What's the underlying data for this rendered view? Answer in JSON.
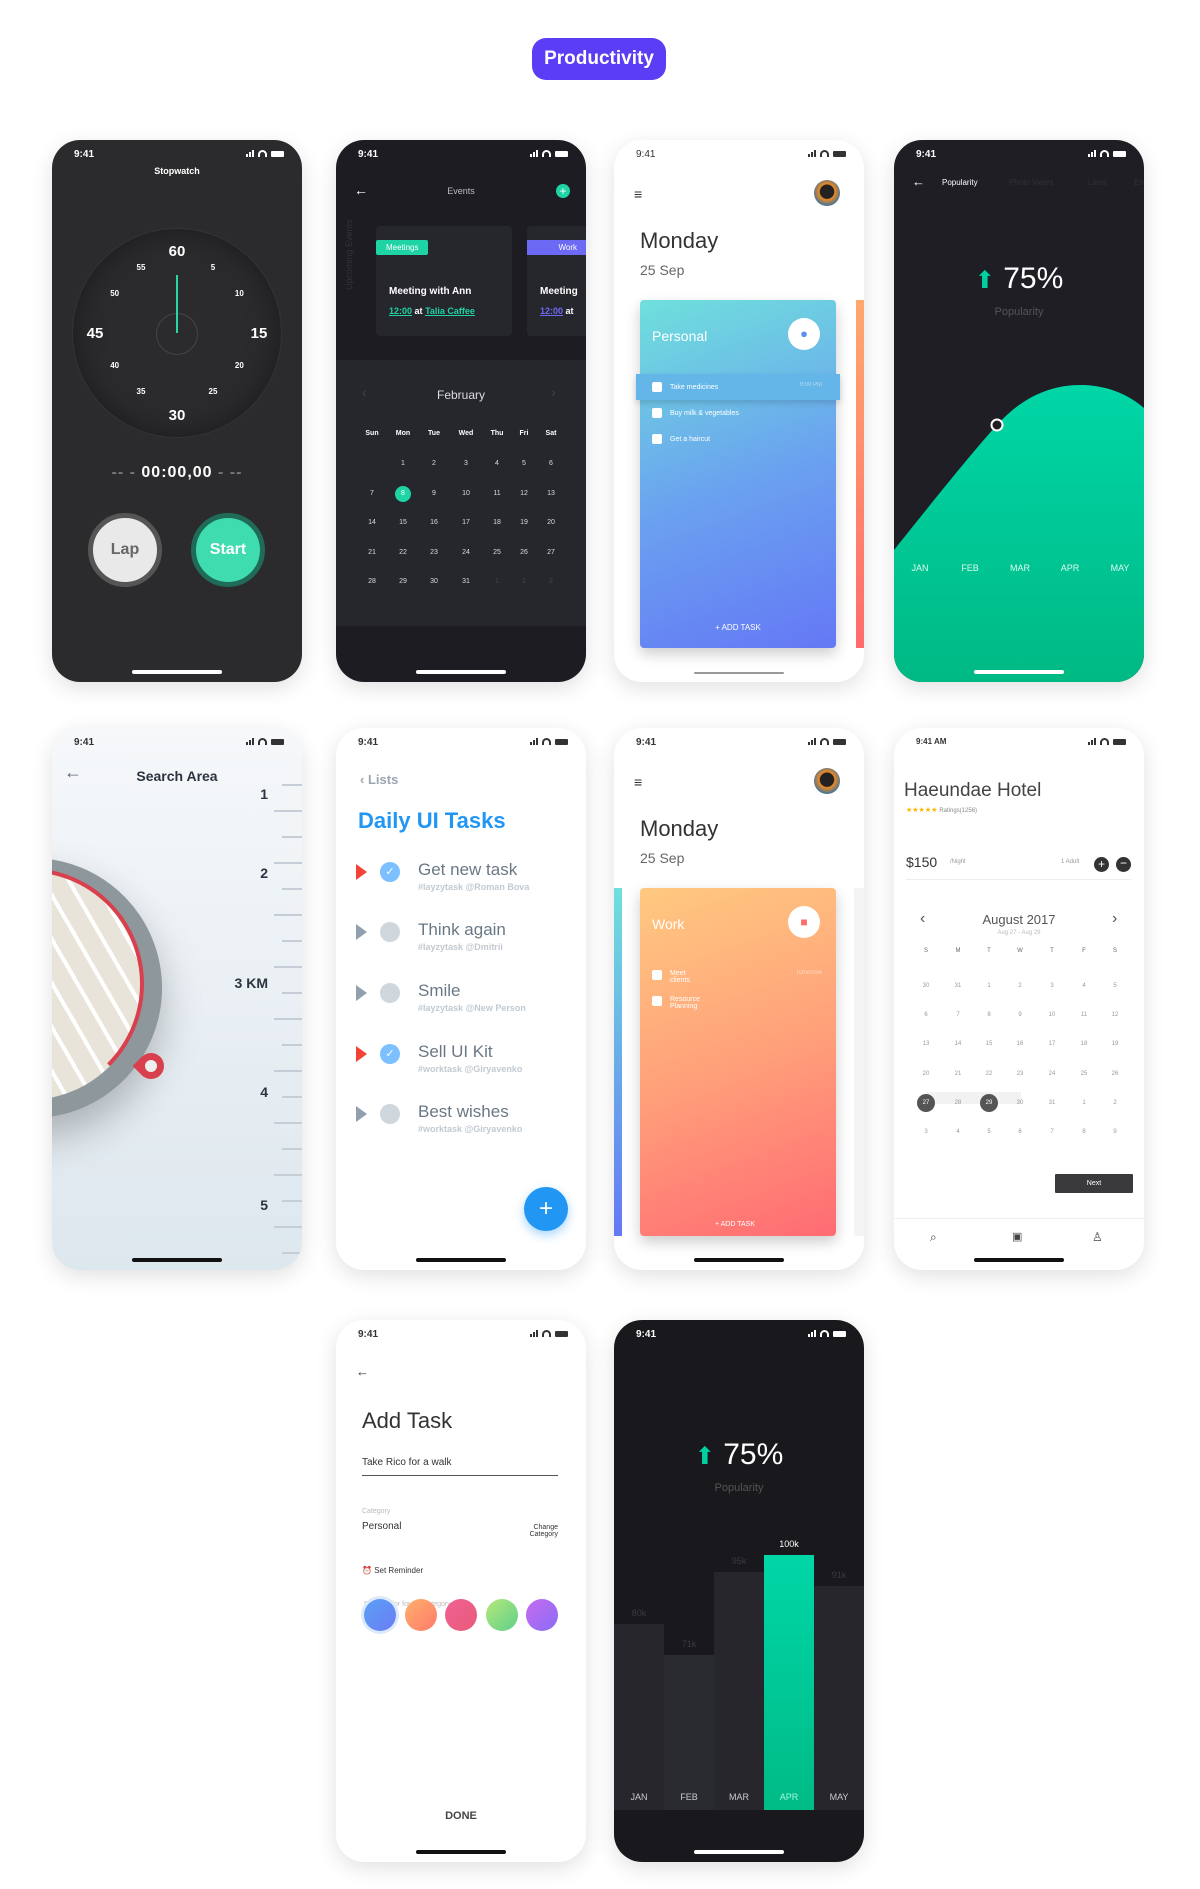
{
  "badge": "Productivity",
  "status_time": "9:41",
  "stopwatch": {
    "title": "Stopwatch",
    "dial": [
      "60",
      "5",
      "10",
      "15",
      "20",
      "25",
      "30",
      "35",
      "40",
      "45",
      "50",
      "55"
    ],
    "readout": "00:00,00",
    "lap": "Lap",
    "start": "Start"
  },
  "events": {
    "title": "Events",
    "side_label": "Upcoming Events",
    "cards": [
      {
        "tag": "Meetings",
        "title": "Meeting with Ann",
        "time": "12:00",
        "at": "at",
        "place": "Talia Caffee",
        "color": "#1ed3a4"
      },
      {
        "tag": "Work",
        "title": "Meeting",
        "time": "12:00",
        "at": "at",
        "color": "#6c6af4"
      }
    ],
    "month": "February",
    "weekdays": [
      "Sun",
      "Mon",
      "Tue",
      "Wed",
      "Thu",
      "Fri",
      "Sat"
    ],
    "rows": [
      [
        "",
        "1",
        "2",
        "3",
        "4",
        "5",
        "6"
      ],
      [
        "7",
        "8",
        "9",
        "10",
        "11",
        "12",
        "13"
      ],
      [
        "14",
        "15",
        "16",
        "17",
        "18",
        "19",
        "20"
      ],
      [
        "21",
        "22",
        "23",
        "24",
        "25",
        "26",
        "27"
      ],
      [
        "28",
        "29",
        "30",
        "31",
        "1",
        "2",
        "3"
      ]
    ],
    "selected": "8",
    "accent": "#1ed3a4"
  },
  "personal": {
    "day": "Monday",
    "date": "25 Sep",
    "card": "Personal",
    "tasks": [
      "Take medicines",
      "Buy milk & vegetables",
      "Get a haircut"
    ],
    "reminder": "9:00 PM",
    "add": "ADD TASK"
  },
  "popularity": {
    "tabs": [
      "Popularity",
      "Photo Views",
      "Likes",
      "En"
    ],
    "value": "75%",
    "label": "Popularity",
    "months": [
      "JAN",
      "FEB",
      "MAR",
      "APR",
      "MAY"
    ],
    "accent": "#00d1a0"
  },
  "search": {
    "title": "Search Area",
    "ruler": [
      "1",
      "2",
      "3 KM",
      "4",
      "5"
    ]
  },
  "tasks": {
    "back": "Lists",
    "title": "Daily UI Tasks",
    "items": [
      {
        "name": "Get new task",
        "tag": "#layzytask",
        "user": "@Roman Bova",
        "done": true
      },
      {
        "name": "Think again",
        "tag": "#layzytask",
        "user": "@Dmitrii",
        "done": false
      },
      {
        "name": "Smile",
        "tag": "#layzytask",
        "user": "@New Person",
        "done": false
      },
      {
        "name": "Sell UI Kit",
        "tag": "#worktask",
        "user": "@Giryavenko",
        "done": true
      },
      {
        "name": "Best wishes",
        "tag": "#worktask",
        "user": "@Giryavenko",
        "done": false
      }
    ],
    "fab": "+"
  },
  "work": {
    "day": "Monday",
    "date": "25 Sep",
    "card": "Work",
    "tasks": [
      "Meet clients",
      "Resource Planning"
    ],
    "reminder": "Tomorrow",
    "add": "ADD TASK"
  },
  "hotel": {
    "time": "9:41 AM",
    "name": "Haeundae Hotel",
    "stars": "★★★★★",
    "ratings": "Ratings(1256)",
    "price": "$150",
    "per": "/Night",
    "guests": "1 Adult",
    "month": "August 2017",
    "range": "Aug 27 - Aug 29",
    "weekdays": [
      "S",
      "M",
      "T",
      "W",
      "T",
      "F",
      "S"
    ],
    "rows": [
      [
        "30",
        "31",
        "1",
        "2",
        "3",
        "4",
        "5"
      ],
      [
        "6",
        "7",
        "8",
        "9",
        "10",
        "11",
        "12"
      ],
      [
        "13",
        "14",
        "15",
        "16",
        "17",
        "18",
        "19"
      ],
      [
        "20",
        "21",
        "22",
        "23",
        "24",
        "25",
        "26"
      ],
      [
        "27",
        "28",
        "29",
        "30",
        "31",
        "1",
        "2"
      ],
      [
        "3",
        "4",
        "5",
        "6",
        "7",
        "8",
        "9"
      ]
    ],
    "selected": [
      "27",
      "29"
    ],
    "next": "Next"
  },
  "add_task": {
    "title": "Add Task",
    "input": "Take Rico for a walk",
    "category_label": "Category",
    "category": "Personal",
    "change": "Change Category",
    "reminder": "Set Reminder",
    "pick": "Pick a color for the category",
    "colors": [
      [
        "#5aa0f5",
        "#6b7cf5"
      ],
      [
        "#ffb06b",
        "#ff7a6b"
      ],
      [
        "#f06292",
        "#e85a7a"
      ],
      [
        "#b5e87a",
        "#5fd08a"
      ],
      [
        "#c56cf0",
        "#8a6cf5"
      ]
    ],
    "done": "DONE"
  },
  "chart_data": {
    "type": "bar",
    "categories": [
      "JAN",
      "FEB",
      "MAR",
      "APR",
      "MAY"
    ],
    "values": [
      80,
      71,
      95,
      100,
      91
    ],
    "value_labels": [
      "80k",
      "71k",
      "95k",
      "100k",
      "91k"
    ],
    "highlight": "APR",
    "headline": "75%",
    "subtitle": "Popularity"
  }
}
